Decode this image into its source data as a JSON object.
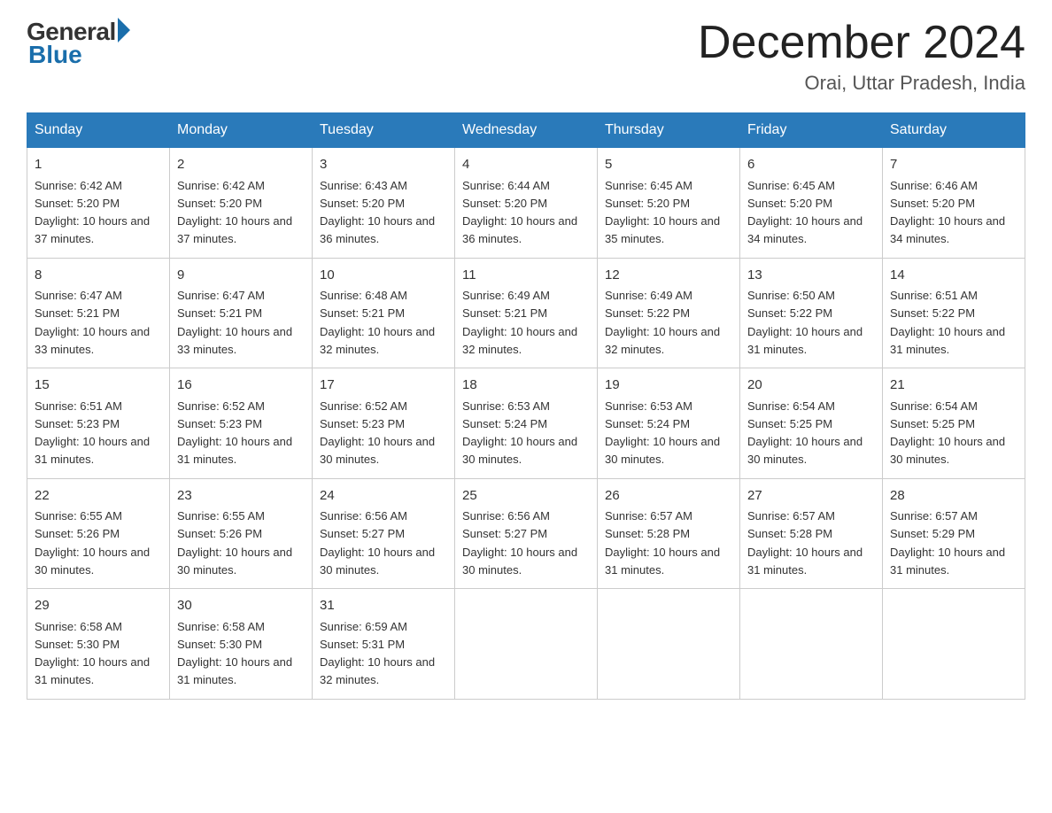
{
  "logo": {
    "general": "General",
    "blue": "Blue"
  },
  "header": {
    "month": "December 2024",
    "location": "Orai, Uttar Pradesh, India"
  },
  "days_of_week": [
    "Sunday",
    "Monday",
    "Tuesday",
    "Wednesday",
    "Thursday",
    "Friday",
    "Saturday"
  ],
  "weeks": [
    [
      {
        "num": "1",
        "sunrise": "6:42 AM",
        "sunset": "5:20 PM",
        "daylight": "10 hours and 37 minutes."
      },
      {
        "num": "2",
        "sunrise": "6:42 AM",
        "sunset": "5:20 PM",
        "daylight": "10 hours and 37 minutes."
      },
      {
        "num": "3",
        "sunrise": "6:43 AM",
        "sunset": "5:20 PM",
        "daylight": "10 hours and 36 minutes."
      },
      {
        "num": "4",
        "sunrise": "6:44 AM",
        "sunset": "5:20 PM",
        "daylight": "10 hours and 36 minutes."
      },
      {
        "num": "5",
        "sunrise": "6:45 AM",
        "sunset": "5:20 PM",
        "daylight": "10 hours and 35 minutes."
      },
      {
        "num": "6",
        "sunrise": "6:45 AM",
        "sunset": "5:20 PM",
        "daylight": "10 hours and 34 minutes."
      },
      {
        "num": "7",
        "sunrise": "6:46 AM",
        "sunset": "5:20 PM",
        "daylight": "10 hours and 34 minutes."
      }
    ],
    [
      {
        "num": "8",
        "sunrise": "6:47 AM",
        "sunset": "5:21 PM",
        "daylight": "10 hours and 33 minutes."
      },
      {
        "num": "9",
        "sunrise": "6:47 AM",
        "sunset": "5:21 PM",
        "daylight": "10 hours and 33 minutes."
      },
      {
        "num": "10",
        "sunrise": "6:48 AM",
        "sunset": "5:21 PM",
        "daylight": "10 hours and 32 minutes."
      },
      {
        "num": "11",
        "sunrise": "6:49 AM",
        "sunset": "5:21 PM",
        "daylight": "10 hours and 32 minutes."
      },
      {
        "num": "12",
        "sunrise": "6:49 AM",
        "sunset": "5:22 PM",
        "daylight": "10 hours and 32 minutes."
      },
      {
        "num": "13",
        "sunrise": "6:50 AM",
        "sunset": "5:22 PM",
        "daylight": "10 hours and 31 minutes."
      },
      {
        "num": "14",
        "sunrise": "6:51 AM",
        "sunset": "5:22 PM",
        "daylight": "10 hours and 31 minutes."
      }
    ],
    [
      {
        "num": "15",
        "sunrise": "6:51 AM",
        "sunset": "5:23 PM",
        "daylight": "10 hours and 31 minutes."
      },
      {
        "num": "16",
        "sunrise": "6:52 AM",
        "sunset": "5:23 PM",
        "daylight": "10 hours and 31 minutes."
      },
      {
        "num": "17",
        "sunrise": "6:52 AM",
        "sunset": "5:23 PM",
        "daylight": "10 hours and 30 minutes."
      },
      {
        "num": "18",
        "sunrise": "6:53 AM",
        "sunset": "5:24 PM",
        "daylight": "10 hours and 30 minutes."
      },
      {
        "num": "19",
        "sunrise": "6:53 AM",
        "sunset": "5:24 PM",
        "daylight": "10 hours and 30 minutes."
      },
      {
        "num": "20",
        "sunrise": "6:54 AM",
        "sunset": "5:25 PM",
        "daylight": "10 hours and 30 minutes."
      },
      {
        "num": "21",
        "sunrise": "6:54 AM",
        "sunset": "5:25 PM",
        "daylight": "10 hours and 30 minutes."
      }
    ],
    [
      {
        "num": "22",
        "sunrise": "6:55 AM",
        "sunset": "5:26 PM",
        "daylight": "10 hours and 30 minutes."
      },
      {
        "num": "23",
        "sunrise": "6:55 AM",
        "sunset": "5:26 PM",
        "daylight": "10 hours and 30 minutes."
      },
      {
        "num": "24",
        "sunrise": "6:56 AM",
        "sunset": "5:27 PM",
        "daylight": "10 hours and 30 minutes."
      },
      {
        "num": "25",
        "sunrise": "6:56 AM",
        "sunset": "5:27 PM",
        "daylight": "10 hours and 30 minutes."
      },
      {
        "num": "26",
        "sunrise": "6:57 AM",
        "sunset": "5:28 PM",
        "daylight": "10 hours and 31 minutes."
      },
      {
        "num": "27",
        "sunrise": "6:57 AM",
        "sunset": "5:28 PM",
        "daylight": "10 hours and 31 minutes."
      },
      {
        "num": "28",
        "sunrise": "6:57 AM",
        "sunset": "5:29 PM",
        "daylight": "10 hours and 31 minutes."
      }
    ],
    [
      {
        "num": "29",
        "sunrise": "6:58 AM",
        "sunset": "5:30 PM",
        "daylight": "10 hours and 31 minutes."
      },
      {
        "num": "30",
        "sunrise": "6:58 AM",
        "sunset": "5:30 PM",
        "daylight": "10 hours and 31 minutes."
      },
      {
        "num": "31",
        "sunrise": "6:59 AM",
        "sunset": "5:31 PM",
        "daylight": "10 hours and 32 minutes."
      },
      null,
      null,
      null,
      null
    ]
  ]
}
